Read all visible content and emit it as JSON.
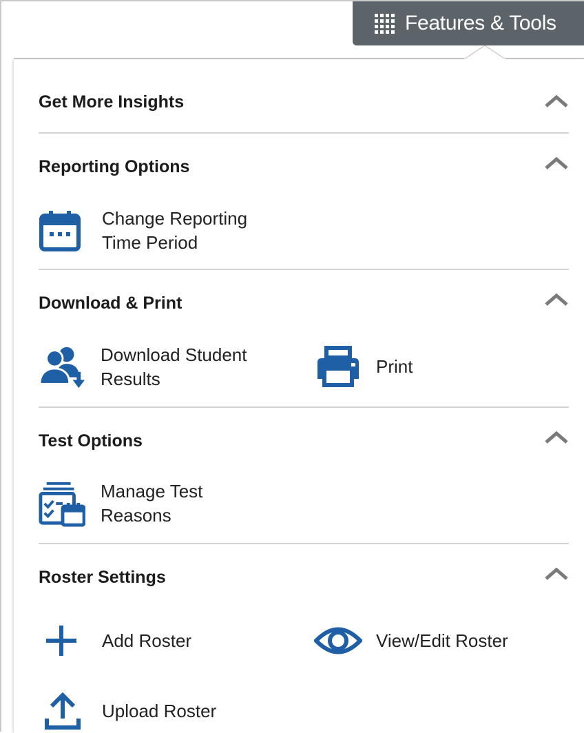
{
  "header": {
    "features_tools_label": "Features & Tools"
  },
  "sections": {
    "insights": {
      "title": "Get More Insights"
    },
    "reporting": {
      "title": "Reporting Options",
      "change_period_line1": "Change Reporting",
      "change_period_line2": "Time Period"
    },
    "download": {
      "title": "Download & Print",
      "download_line1": "Download Student",
      "download_line2": "Results",
      "print_label": "Print"
    },
    "test": {
      "title": "Test Options",
      "manage_line1": "Manage Test",
      "manage_line2": "Reasons"
    },
    "roster": {
      "title": "Roster Settings",
      "add_label": "Add Roster",
      "view_edit_label": "View/Edit Roster",
      "upload_label": "Upload Roster"
    }
  },
  "icons": {
    "tab": "grid-dots-icon",
    "collapse": "chevron-up-icon",
    "calendar": "calendar-icon",
    "download_users": "download-users-icon",
    "print": "printer-icon",
    "manage_reasons": "manage-reasons-icon",
    "add": "plus-icon",
    "view": "eye-icon",
    "upload": "upload-icon"
  },
  "colors": {
    "accent": "#1f5fa6",
    "tab_bg": "#5d6469",
    "chevron": "#7a7a7a",
    "divider": "#d3d3d3"
  }
}
